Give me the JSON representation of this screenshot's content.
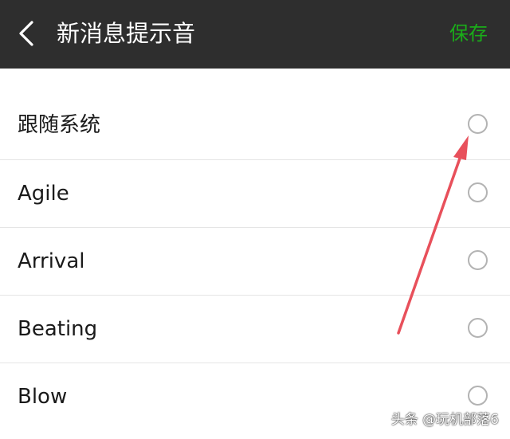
{
  "header": {
    "title": "新消息提示音",
    "save_label": "保存",
    "back_icon": "chevron-left-icon"
  },
  "sounds": [
    {
      "label": "跟随系统",
      "selected": false
    },
    {
      "label": "Agile",
      "selected": false
    },
    {
      "label": "Arrival",
      "selected": false
    },
    {
      "label": "Beating",
      "selected": false
    },
    {
      "label": "Blow",
      "selected": false
    }
  ],
  "watermark": "头条 @玩机部落6",
  "colors": {
    "topbar": "#2e2e2e",
    "title": "#ffffff",
    "save": "#1aad19",
    "radio_border": "#b3b3b3",
    "divider": "#e5e5e5",
    "annotation_arrow": "#e8505b"
  }
}
